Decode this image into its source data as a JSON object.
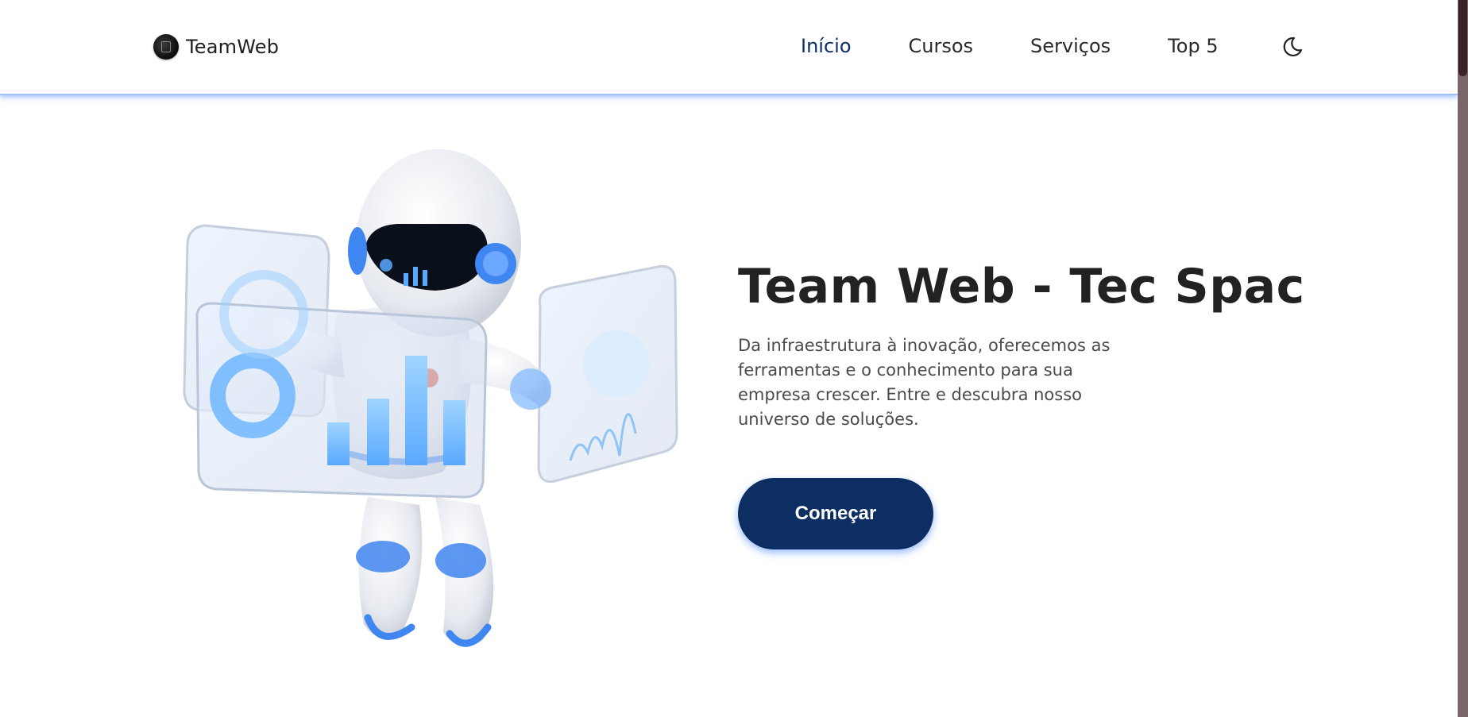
{
  "brand": {
    "name": "TeamWeb",
    "logo_icon": "teamweb-logo-icon"
  },
  "nav": {
    "items": [
      {
        "label": "Início",
        "active": true
      },
      {
        "label": "Cursos",
        "active": false
      },
      {
        "label": "Serviços",
        "active": false
      },
      {
        "label": "Top 5",
        "active": false
      }
    ],
    "theme_toggle_icon": "moon-icon"
  },
  "hero": {
    "title": "Team Web - Tec Spac",
    "description": "Da infraestrutura à inovação, oferecemos as ferramentas e o conhecimento para sua empresa crescer. Entre e descubra nosso universo de soluções.",
    "cta_label": "Começar",
    "illustration": "astronaut-with-holographic-dashboards"
  },
  "colors": {
    "accent": "#0d2e63",
    "highlight": "#4a8cf2",
    "text": "#222222"
  }
}
